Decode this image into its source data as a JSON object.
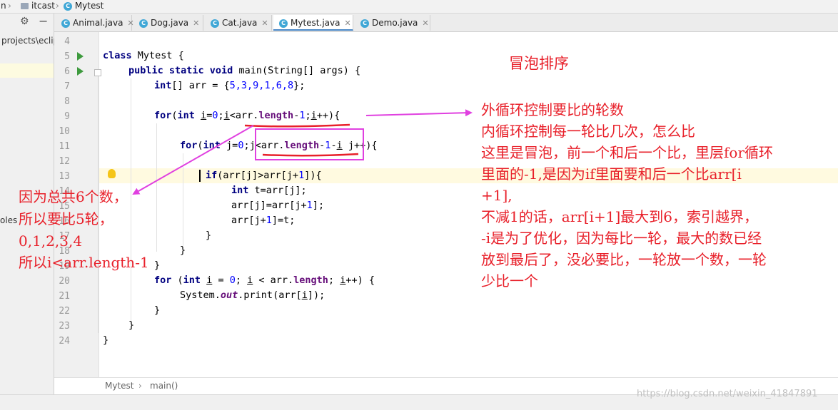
{
  "breadcrumb": {
    "item1": "n",
    "item2": "itcast",
    "item3": "Mytest"
  },
  "left_panel": {
    "path_text": "projects\\eclip",
    "side_text": "oles"
  },
  "tabs": [
    "Animal.java",
    "Dog.java",
    "Cat.java",
    "Mytest.java",
    "Demo.java"
  ],
  "active_tab": "Mytest.java",
  "line_numbers": [
    "4",
    "5",
    "6",
    "7",
    "8",
    "9",
    "10",
    "11",
    "12",
    "13",
    "14",
    "15",
    "16",
    "17",
    "18",
    "19",
    "20",
    "21",
    "22",
    "23",
    "24"
  ],
  "code": {
    "l5_kw": "class",
    "l5_rest": " Mytest {",
    "l6_kw": "public static void",
    "l6_rest": " main(String[] args) {",
    "l7_kw": "int",
    "l7_a": "[] arr = {",
    "l7_vals": "5,3,9,1,6,8",
    "l7_b": "};",
    "l9_kw": "for",
    "l9_a": "(",
    "l9_kw2": "int",
    "l9_b": " ",
    "l9_i1": "i",
    "l9_c": "=",
    "l9_n0": "0",
    "l9_d": ";",
    "l9_i2": "i",
    "l9_e": "<arr.",
    "l9_len": "length",
    "l9_f": "-",
    "l9_n1": "1",
    "l9_g": ";",
    "l9_i3": "i",
    "l9_h": "++){",
    "l11_kw": "for",
    "l11_a": "(",
    "l11_kw2": "int",
    "l11_b": " j=",
    "l11_n0": "0",
    "l11_c": ";",
    "l11_d": "j<arr.",
    "l11_len": "length",
    "l11_e": "-",
    "l11_n1": "1",
    "l11_f": "-",
    "l11_i": "i",
    "l11_g": " j++){",
    "l13_kw": "if",
    "l13_a": "(arr[j]>arr[j+",
    "l13_n": "1",
    "l13_b": "]){",
    "l14_kw": "int",
    "l14_rest": " t=arr[j];",
    "l15_a": "arr[j]=arr[j+",
    "l15_n": "1",
    "l15_b": "];",
    "l16_a": "arr[j+",
    "l16_n": "1",
    "l16_b": "]=t;",
    "l17": "}",
    "l18": "}",
    "l19": "}",
    "l20_kw": "for",
    "l20_a": " (",
    "l20_kw2": "int",
    "l20_b": " ",
    "l20_i1": "i",
    "l20_c": " = ",
    "l20_n0": "0",
    "l20_d": "; ",
    "l20_i2": "i",
    "l20_e": " < arr.",
    "l20_len": "length",
    "l20_f": "; ",
    "l20_i3": "i",
    "l20_g": "++) {",
    "l21_a": "System.",
    "l21_out": "out",
    "l21_b": ".print(arr[",
    "l21_i": "i",
    "l21_c": "]);",
    "l22": "}",
    "l23": "}",
    "l24": "}"
  },
  "status": {
    "class": "Mytest",
    "method": "main()"
  },
  "annotations": {
    "title": "冒泡排序",
    "right": [
      "外循环控制要比的轮数",
      "内循环控制每一轮比几次，怎么比",
      "这里是冒泡，前一个和后一个比，里层for循环",
      "里面的-1,是因为if里面要和后一个比arr[i",
      "+1],",
      "不减1的话，arr[i+1]最大到6，索引越界，",
      "-i是为了优化，因为每比一轮，最大的数已经",
      "放到最后了，没必要比，一轮放一个数，一轮",
      "少比一个"
    ],
    "left": [
      "因为总共6个数，",
      "所以要比5轮，",
      "0,1,2,3,4",
      "所以i<arr.length-1"
    ]
  },
  "watermark": "https://blog.csdn.net/weixin_41847891",
  "colors": {
    "annotation": "#e8202a",
    "arrow": "#e040e0",
    "keyword": "#000080",
    "number": "#0000ff",
    "field": "#660e7a"
  }
}
